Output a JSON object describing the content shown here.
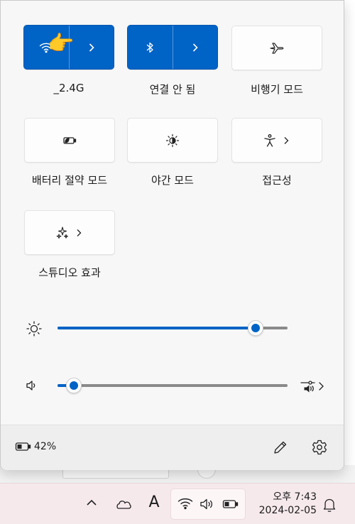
{
  "quick_settings": {
    "tiles": [
      {
        "id": "wifi",
        "label": "_2.4G",
        "active": true,
        "icon": "wifi-icon",
        "has_chevron": true
      },
      {
        "id": "bluetooth",
        "label": "연결 안 됨",
        "active": true,
        "icon": "bluetooth-icon",
        "has_chevron": true
      },
      {
        "id": "airplane",
        "label": "비행기 모드",
        "active": false,
        "icon": "airplane-icon"
      },
      {
        "id": "battery-saver",
        "label": "배터리 절약 모드",
        "active": false,
        "icon": "battery-saver-icon"
      },
      {
        "id": "night-light",
        "label": "야간 모드",
        "active": false,
        "icon": "night-light-icon"
      },
      {
        "id": "accessibility",
        "label": "접근성",
        "active": false,
        "icon": "accessibility-icon",
        "has_chevron": true
      },
      {
        "id": "studio-effects",
        "label": "스튜디오 효과",
        "active": false,
        "icon": "studio-effects-icon",
        "has_chevron": true
      }
    ],
    "brightness": {
      "icon": "brightness-icon",
      "level_fraction": 0.86
    },
    "volume": {
      "icon": "volume-icon",
      "level_fraction": 0.07,
      "output_icon": "audio-output-select-icon"
    },
    "accent_color": "#0063c6"
  },
  "footer": {
    "battery_percent": "42%",
    "edit_icon": "pencil-icon",
    "settings_icon": "gear-icon"
  },
  "taskbar": {
    "time": "오후 7:43",
    "date": "2024-02-05",
    "ime_indicator": "A",
    "icons": [
      "chevron-up-icon",
      "onedrive-cloud-icon",
      "wifi-icon",
      "speaker-icon",
      "battery-icon",
      "bell-icon"
    ]
  }
}
